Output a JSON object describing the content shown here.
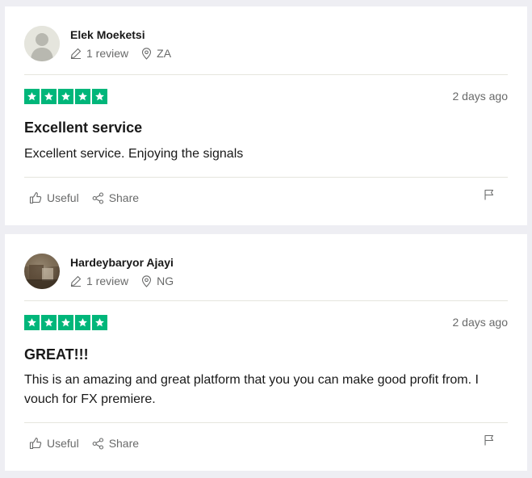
{
  "reviews": [
    {
      "consumer": {
        "name": "Elek Moeketsi",
        "review_count": "1 review",
        "country": "ZA"
      },
      "rating": 5,
      "date": "2 days ago",
      "title": "Excellent service",
      "body": "Excellent service. Enjoying the signals",
      "actions": {
        "useful": "Useful",
        "share": "Share"
      }
    },
    {
      "consumer": {
        "name": "Hardeybaryor Ajayi",
        "review_count": "1 review",
        "country": "NG"
      },
      "rating": 5,
      "date": "2 days ago",
      "title": "GREAT!!!",
      "body": "This is an amazing and great platform that you you can make good profit from. I vouch for FX premiere.",
      "actions": {
        "useful": "Useful",
        "share": "Share"
      }
    }
  ],
  "colors": {
    "star_green": "#00b67a",
    "muted_text": "#696a6a",
    "divider": "#e5e5dd",
    "page_bg": "#eeeef3"
  },
  "icons": [
    "default-avatar-icon",
    "pencil-icon",
    "location-pin-icon",
    "star-icon",
    "thumbs-up-icon",
    "share-icon",
    "flag-icon"
  ]
}
